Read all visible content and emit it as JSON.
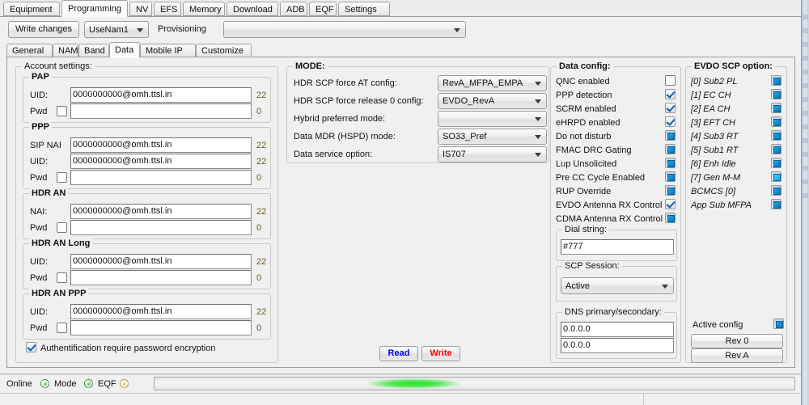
{
  "window": {
    "top_tabs": [
      {
        "label": "Equipment",
        "selected": false
      },
      {
        "label": "Programming",
        "selected": true
      },
      {
        "label": "NV",
        "selected": false
      },
      {
        "label": "EFS",
        "selected": false
      },
      {
        "label": "Memory",
        "selected": false
      },
      {
        "label": "Download",
        "selected": false
      },
      {
        "label": "ADB",
        "selected": false
      },
      {
        "label": "EQF",
        "selected": false
      },
      {
        "label": "Settings",
        "selected": false
      }
    ]
  },
  "toolbar": {
    "write_changes_label": "Write changes",
    "nam_select_value": "UseNam1",
    "provisioning_label": "Provisioning",
    "provisioning_value": ""
  },
  "sub_tabs": [
    {
      "label": "General",
      "selected": false
    },
    {
      "label": "NAM",
      "selected": false
    },
    {
      "label": "Band",
      "selected": false
    },
    {
      "label": "Data",
      "selected": true
    },
    {
      "label": "Mobile IP",
      "selected": false
    },
    {
      "label": "Customize",
      "selected": false
    }
  ],
  "account_settings": {
    "title": "Account settings:",
    "groups": [
      {
        "title": "PAP",
        "rows": [
          {
            "label": "UID:",
            "value": "0000000000@omh.ttsl.in",
            "count": "22",
            "checkbox": null
          },
          {
            "label": "Pwd",
            "value": "",
            "count": "0",
            "checkbox": "empty"
          }
        ]
      },
      {
        "title": "PPP",
        "rows": [
          {
            "label": "SIP NAI",
            "value": "0000000000@omh.ttsl.in",
            "count": "22",
            "checkbox": null
          },
          {
            "label": "UID:",
            "value": "0000000000@omh.ttsl.in",
            "count": "22",
            "checkbox": null
          },
          {
            "label": "Pwd",
            "value": "",
            "count": "0",
            "checkbox": "empty"
          }
        ]
      },
      {
        "title": "HDR AN",
        "rows": [
          {
            "label": "NAI:",
            "value": "0000000000@omh.ttsl.in",
            "count": "22",
            "checkbox": null
          },
          {
            "label": "Pwd",
            "value": "",
            "count": "0",
            "checkbox": "empty"
          }
        ]
      },
      {
        "title": "HDR AN Long",
        "rows": [
          {
            "label": "UID:",
            "value": "0000000000@omh.ttsl.in",
            "count": "22",
            "checkbox": null
          },
          {
            "label": "Pwd",
            "value": "",
            "count": "0",
            "checkbox": "empty"
          }
        ]
      },
      {
        "title": "HDR AN PPP",
        "rows": [
          {
            "label": "UID:",
            "value": "0000000000@omh.ttsl.in",
            "count": "22",
            "checkbox": null
          },
          {
            "label": "Pwd",
            "value": "",
            "count": "0",
            "checkbox": "empty"
          }
        ]
      }
    ],
    "auth_checkbox_label": "Authentification require password encryption",
    "auth_checkbox_state": "checked"
  },
  "mode": {
    "title": "MODE:",
    "rows": [
      {
        "label": "HDR SCP force AT config:",
        "value": "RevA_MFPA_EMPA"
      },
      {
        "label": "HDR SCP force release 0 config:",
        "value": "EVDO_RevA"
      },
      {
        "label": "Hybrid preferred mode:",
        "value": ""
      },
      {
        "label": "Data MDR (HSPD) mode:",
        "value": "SO33_Pref"
      },
      {
        "label": "Data service option:",
        "value": "IS707"
      }
    ],
    "read_label": "Read",
    "write_label": "Write",
    "read_color": "#0000ff",
    "write_color": "#ff0000"
  },
  "data_config": {
    "title": "Data config:",
    "items": [
      {
        "label": "QNC enabled",
        "state": "empty"
      },
      {
        "label": "PPP detection",
        "state": "checked"
      },
      {
        "label": "SCRM enabled",
        "state": "checked"
      },
      {
        "label": "eHRPD enabled",
        "state": "checked"
      },
      {
        "label": "Do not disturb",
        "state": "filled"
      },
      {
        "label": "FMAC DRC Gating",
        "state": "filled"
      },
      {
        "label": "Lup Unsolicited",
        "state": "filled"
      },
      {
        "label": "Pre CC Cycle Enabled",
        "state": "filled"
      },
      {
        "label": "RUP Override",
        "state": "filled"
      },
      {
        "label": "EVDO Antenna RX Control",
        "state": "checked"
      },
      {
        "label": "CDMA Antenna RX Control",
        "state": "filled"
      }
    ],
    "dial_string": {
      "title": "Dial string:",
      "value": "#777"
    },
    "scp_session": {
      "title": "SCP Session:",
      "value": "Active"
    },
    "dns": {
      "title": "DNS primary/secondary:",
      "primary": "0.0.0.0",
      "secondary": "0.0.0.0"
    }
  },
  "evdo_scp": {
    "title": "EVDO SCP option:",
    "items": [
      {
        "label": "[0] Sub2 PL",
        "state": "filled"
      },
      {
        "label": "[1] EC CH",
        "state": "filled"
      },
      {
        "label": "[2] EA CH",
        "state": "filled"
      },
      {
        "label": "[3] EFT CH",
        "state": "filled"
      },
      {
        "label": "[4] Sub3 RT",
        "state": "filled"
      },
      {
        "label": "[5] Sub1 RT",
        "state": "filled"
      },
      {
        "label": "[6] Enh Idle",
        "state": "filled"
      },
      {
        "label": "[7] Gen M-M",
        "state": "filled-bright"
      },
      {
        "label": "BCMCS [0]",
        "state": "filled"
      },
      {
        "label": "App Sub MFPA",
        "state": "filled"
      }
    ],
    "active_config_label": "Active config",
    "active_config_state": "filled",
    "rev0_label": "Rev 0",
    "revA_label": "Rev A"
  },
  "status_bar": {
    "online_label": "Online",
    "online_icon_color": "#35b135",
    "mode_label": "Mode",
    "mode_icon_color": "#35b135",
    "eqf_label": "EQF",
    "eqf_icon_color": "#e8b730",
    "progress_indeterminate": true
  }
}
